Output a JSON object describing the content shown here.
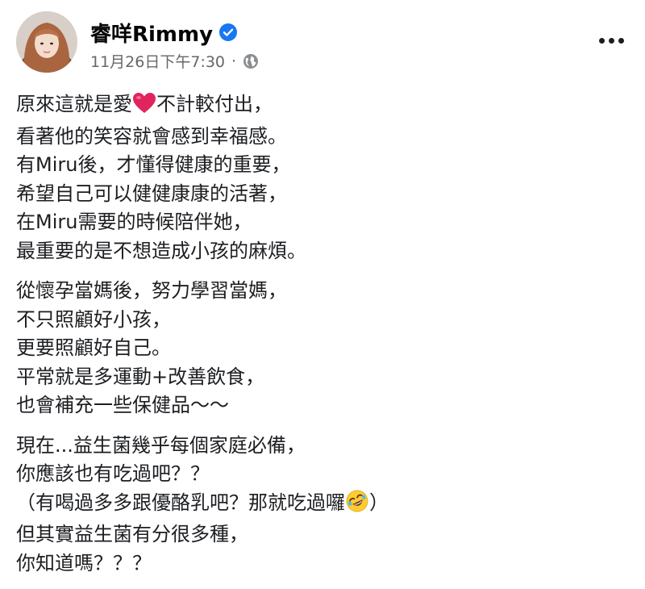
{
  "post": {
    "author": "睿咩Rimmy",
    "verified": true,
    "timestamp": "11月26日下午7:30",
    "separator": "·",
    "privacy_icon": "globe-icon",
    "more_icon": "more-options-icon"
  },
  "body": {
    "p1": {
      "l1a": "原來這就是愛",
      "l1_emoji": "red-heart-emoji",
      "l1b": "不計較付出，",
      "l2": "看著他的笑容就會感到幸福感。",
      "l3": "有Miru後，才懂得健康的重要，",
      "l4": "希望自己可以健健康康的活著，",
      "l5": "在Miru需要的時候陪伴她，",
      "l6": "最重要的是不想造成小孩的麻煩。"
    },
    "p2": {
      "l1": "從懷孕當媽後，努力學習當媽，",
      "l2": "不只照顧好小孩，",
      "l3": "更要照顧好自己。",
      "l4": "平常就是多運動+改善飲食，",
      "l5": "也會補充一些保健品～～"
    },
    "p3": {
      "l1": "現在...益生菌幾乎每個家庭必備，",
      "l2": "你應該也有吃過吧？？",
      "l3a": "（有喝過多多跟優酪乳吧？那就吃過囉",
      "l3_emoji": "rolling-on-floor-laughing-emoji",
      "l3b": "）",
      "l4": "但其實益生菌有分很多種，",
      "l5": "你知道嗎？？？"
    }
  },
  "colors": {
    "text": "#1c1e21",
    "meta": "#65676b",
    "verified_badge": "#1877f2",
    "heart": "#e0245e"
  }
}
